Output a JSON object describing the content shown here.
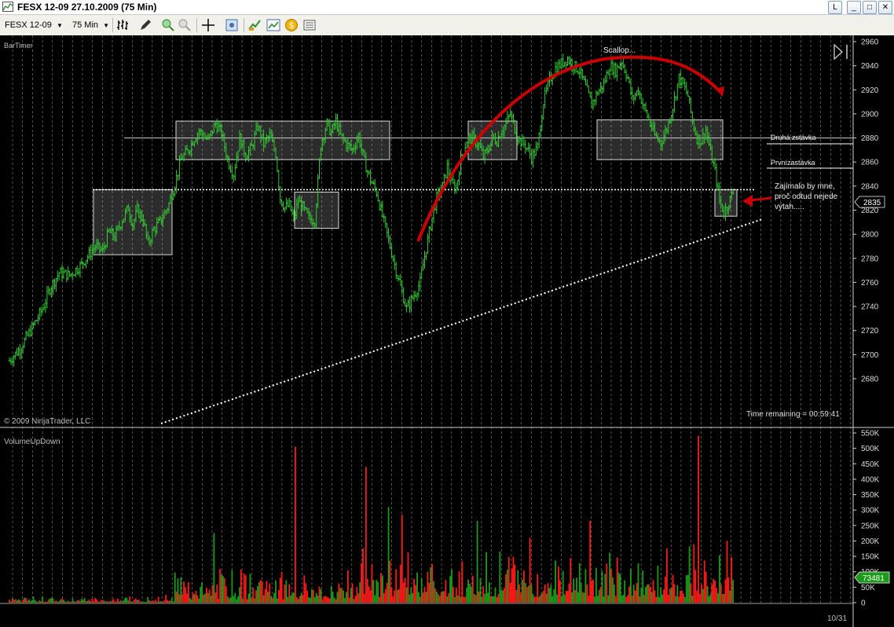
{
  "window": {
    "title": "FESX 12-09   27.10.2009 (75 Min)",
    "restore_label": "L",
    "minimize_glyph": "_",
    "maximize_glyph": "□",
    "close_glyph": "✕"
  },
  "toolbar": {
    "instrument": "FESX 12-09",
    "period": "75 Min",
    "icons": [
      "bar-style-icon",
      "draw-tool-icon",
      "zoom-in-icon",
      "zoom-out-icon",
      "crosshair-icon",
      "properties-icon",
      "strategies-icon",
      "indicators-icon",
      "chart-trader-icon",
      "data-box-icon"
    ]
  },
  "price_panel": {
    "label": "BarTimer",
    "copyright": "© 2009 NinjaTrader, LLC",
    "time_remaining": "Time remaining = 00:59:41",
    "current_price": "2835",
    "annotations": {
      "scallop": "Scallop...",
      "second_level": "Druhá zstávka",
      "first_level": "Prvnízastávka",
      "question_line1": "Zajímalo by mne,",
      "question_line2": "proč odtud nejede",
      "question_line3": "výtah....."
    }
  },
  "volume_panel": {
    "label": "VolumeUpDown",
    "current_volume": "73481"
  },
  "date_label": "10/31",
  "colors": {
    "up_bar": "#33cc33",
    "volume_up": "#1a9c1a",
    "volume_down": "#ff1a1a",
    "arrow": "#cc0000",
    "grid": "#8c8c8c"
  },
  "chart_data": [
    {
      "type": "bar",
      "title": "BarTimer",
      "y_ticks": [
        "2960",
        "2940",
        "2920",
        "2900",
        "2880",
        "2860",
        "2840",
        "2820",
        "2800",
        "2780",
        "2760",
        "2740",
        "2720",
        "2700",
        "2680"
      ],
      "ylim": [
        2670,
        2962
      ],
      "close_path": [
        [
          0,
          2695
        ],
        [
          7,
          2705
        ],
        [
          15,
          2722
        ],
        [
          22,
          2738
        ],
        [
          27,
          2755
        ],
        [
          33,
          2768
        ],
        [
          40,
          2766
        ],
        [
          48,
          2775
        ],
        [
          57,
          2790
        ],
        [
          62,
          2786
        ],
        [
          66,
          2802
        ],
        [
          70,
          2798
        ],
        [
          75,
          2812
        ],
        [
          79,
          2822
        ],
        [
          82,
          2808
        ],
        [
          85,
          2820
        ],
        [
          89,
          2812
        ],
        [
          92,
          2792
        ],
        [
          96,
          2804
        ],
        [
          101,
          2812
        ],
        [
          106,
          2825
        ],
        [
          110,
          2842
        ],
        [
          114,
          2862
        ],
        [
          119,
          2870
        ],
        [
          122,
          2878
        ],
        [
          126,
          2886
        ],
        [
          132,
          2878
        ],
        [
          137,
          2892
        ],
        [
          141,
          2884
        ],
        [
          145,
          2862
        ],
        [
          149,
          2850
        ],
        [
          153,
          2880
        ],
        [
          157,
          2866
        ],
        [
          161,
          2872
        ],
        [
          165,
          2890
        ],
        [
          169,
          2875
        ],
        [
          173,
          2882
        ],
        [
          177,
          2867
        ],
        [
          180,
          2830
        ],
        [
          183,
          2822
        ],
        [
          186,
          2824
        ],
        [
          189,
          2812
        ],
        [
          192,
          2828
        ],
        [
          195,
          2822
        ],
        [
          199,
          2813
        ],
        [
          203,
          2812
        ],
        [
          207,
          2875
        ],
        [
          211,
          2892
        ],
        [
          214,
          2884
        ],
        [
          217,
          2894
        ],
        [
          220,
          2882
        ],
        [
          224,
          2875
        ],
        [
          228,
          2870
        ],
        [
          232,
          2882
        ],
        [
          236,
          2860
        ],
        [
          240,
          2845
        ],
        [
          244,
          2835
        ],
        [
          249,
          2810
        ],
        [
          253,
          2790
        ],
        [
          257,
          2770
        ],
        [
          261,
          2752
        ],
        [
          264,
          2738
        ],
        [
          267,
          2745
        ],
        [
          270,
          2752
        ],
        [
          273,
          2760
        ],
        [
          276,
          2782
        ],
        [
          280,
          2808
        ],
        [
          284,
          2830
        ],
        [
          288,
          2840
        ],
        [
          291,
          2856
        ],
        [
          294,
          2842
        ],
        [
          297,
          2838
        ],
        [
          300,
          2862
        ],
        [
          304,
          2878
        ],
        [
          308,
          2880
        ],
        [
          312,
          2874
        ],
        [
          315,
          2864
        ],
        [
          318,
          2870
        ],
        [
          321,
          2880
        ],
        [
          324,
          2878
        ],
        [
          327,
          2886
        ],
        [
          330,
          2892
        ],
        [
          333,
          2900
        ],
        [
          336,
          2888
        ],
        [
          339,
          2878
        ],
        [
          343,
          2874
        ],
        [
          347,
          2864
        ],
        [
          351,
          2872
        ],
        [
          355,
          2910
        ],
        [
          359,
          2928
        ],
        [
          363,
          2938
        ],
        [
          367,
          2942
        ],
        [
          371,
          2946
        ],
        [
          375,
          2940
        ],
        [
          379,
          2936
        ],
        [
          383,
          2922
        ],
        [
          387,
          2908
        ],
        [
          391,
          2918
        ],
        [
          395,
          2925
        ],
        [
          399,
          2940
        ],
        [
          403,
          2936
        ],
        [
          407,
          2944
        ],
        [
          411,
          2930
        ],
        [
          414,
          2912
        ],
        [
          418,
          2920
        ],
        [
          421,
          2908
        ],
        [
          425,
          2895
        ],
        [
          429,
          2882
        ],
        [
          433,
          2876
        ],
        [
          437,
          2888
        ],
        [
          441,
          2906
        ],
        [
          445,
          2930
        ],
        [
          448,
          2924
        ],
        [
          451,
          2915
        ],
        [
          454,
          2894
        ],
        [
          457,
          2880
        ],
        [
          460,
          2878
        ],
        [
          463,
          2887
        ],
        [
          466,
          2868
        ],
        [
          469,
          2852
        ],
        [
          472,
          2828
        ],
        [
          475,
          2818
        ],
        [
          478,
          2826
        ],
        [
          481,
          2835
        ]
      ],
      "boxes": [
        {
          "from": [
            119,
            2837
          ],
          "to": [
            219,
            2783
          ]
        },
        {
          "from": [
            224,
            2894
          ],
          "to": [
            496,
            2862
          ]
        },
        {
          "from": [
            375,
            2835
          ],
          "to": [
            431,
            2805
          ]
        },
        {
          "from": [
            596,
            2894
          ],
          "to": [
            658,
            2862
          ]
        },
        {
          "from": [
            760,
            2895
          ],
          "to": [
            920,
            2862
          ]
        },
        {
          "from": [
            910,
            2837
          ],
          "to": [
            938,
            2815
          ]
        }
      ],
      "horizontal_levels": [
        2880,
        2861,
        2837
      ],
      "trendline": [
        [
          0,
          2675
        ],
        [
          481,
          2822
        ]
      ],
      "current_price": 2835
    },
    {
      "type": "bar",
      "title": "VolumeUpDown",
      "y_ticks": [
        "550K",
        "500K",
        "450K",
        "400K",
        "350K",
        "300K",
        "250K",
        "200K",
        "150K",
        "100K",
        "50K",
        "0"
      ],
      "ylim": [
        0,
        550000
      ],
      "spikes": [
        {
          "bar": 190,
          "value": 505000,
          "dir": "down"
        },
        {
          "bar": 237,
          "value": 440000,
          "dir": "down"
        },
        {
          "bar": 458,
          "value": 540000,
          "dir": "down"
        },
        {
          "bar": 136,
          "value": 225000,
          "dir": "up"
        },
        {
          "bar": 252,
          "value": 310000,
          "dir": "up"
        },
        {
          "bar": 261,
          "value": 285000,
          "dir": "down"
        },
        {
          "bar": 311,
          "value": 265000,
          "dir": "up"
        },
        {
          "bar": 386,
          "value": 265000,
          "dir": "down"
        },
        {
          "bar": 346,
          "value": 210000,
          "dir": "down"
        }
      ],
      "last_value": 73481
    }
  ]
}
